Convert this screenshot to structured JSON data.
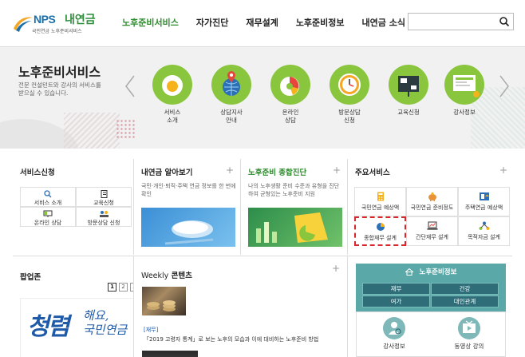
{
  "header": {
    "logo_nps": "NPS",
    "logo_brand": "내연금",
    "logo_sub": "국민연금 노후준비서비스",
    "nav": [
      "노후준비서비스",
      "자가진단",
      "재무설계",
      "노후준비정보",
      "내연금 소식"
    ],
    "search_placeholder": ""
  },
  "hero": {
    "title": "노후준비서비스",
    "desc": "전문 컨설턴트와 강사의 서비스를 받으실 수 있습니다.",
    "services": [
      {
        "label": "서비스\n소개",
        "icon": "egg-icon"
      },
      {
        "label": "상담지사\n안내",
        "icon": "globe-pin-icon"
      },
      {
        "label": "온라인\n상담",
        "icon": "pie-chart-icon"
      },
      {
        "label": "방문상담\n신청",
        "icon": "clock-icon"
      },
      {
        "label": "교육신청",
        "icon": "presentation-board-icon"
      },
      {
        "label": "강사정보",
        "icon": "projector-screen-icon"
      }
    ]
  },
  "cards": {
    "service_request": {
      "title": "서비스신청",
      "items": [
        "서비스 소개",
        "교육신청",
        "온라인 상담",
        "방문상담 신청"
      ]
    },
    "pension_know": {
      "title": "내연금 알아보기",
      "desc": "국민·개인·퇴직·주택 연금 정보를 한 번에 확인"
    },
    "diagnosis": {
      "title": "노후준비 종합진단",
      "desc": "나의 노후생활 준비 수준과 유형을 진단하여 균형있는 노후준비 지원"
    },
    "main_services": {
      "title": "주요서비스",
      "items": [
        "국민연금 예상액",
        "국민연금 준비정도",
        "주택연금 예상액",
        "종합재무 설계",
        "간단재무 설계",
        "목적자금 설계"
      ]
    },
    "popup": {
      "title": "팝업존",
      "pages": [
        "1",
        "2",
        "3"
      ],
      "banner_big": "청렴",
      "banner_small": "해요,\n국민연금"
    },
    "weekly": {
      "title_prefix": "Weekly",
      "title_main": "콘텐츠",
      "tag": "[재무]",
      "text": "「2019 고령자 통계」로 보는 노후의 모습과 이에 대비하는 노후준비 방법"
    },
    "info": {
      "title": "노후준비정보",
      "links": [
        "재무",
        "건강",
        "여가",
        "대인관계"
      ],
      "bottom": [
        "강사정보",
        "동영상 강의"
      ]
    }
  },
  "colors": {
    "accent_green": "#8ac53e",
    "nav_active": "#2e8b2e",
    "info_teal": "#5ba8a8",
    "info_button": "#2f6e78",
    "highlight_red": "#d9262c"
  }
}
